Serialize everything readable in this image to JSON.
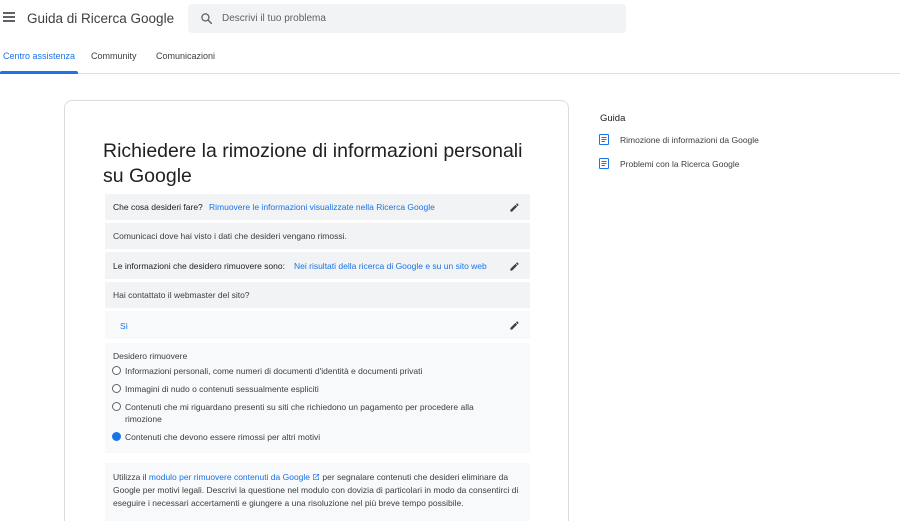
{
  "header": {
    "menu_icon": "hamburger-menu-icon",
    "app_title": "Guida di Ricerca Google",
    "search": {
      "placeholder": "Descrivi il tuo problema",
      "icon": "search-icon"
    }
  },
  "tabs": [
    {
      "label": "Centro assistenza",
      "active": true
    },
    {
      "label": "Community",
      "active": false
    },
    {
      "label": "Comunicazioni",
      "active": false
    }
  ],
  "main": {
    "title": "Richiedere la rimozione di informazioni personali su Google",
    "q1": {
      "label": "Che cosa desideri fare?",
      "answer": "Rimuovere le informazioni visualizzate nella Ricerca Google"
    },
    "instruction": "Comunicaci dove hai visto i dati che desideri vengano rimossi.",
    "q2": {
      "label": "Le informazioni che desidero rimuovere sono:",
      "answer": "Nei risultati della ricerca di Google e su un sito web"
    },
    "q3": {
      "label": "Hai contattato il webmaster del sito?",
      "answer": "Sì"
    },
    "options": {
      "heading": "Desidero rimuovere",
      "items": [
        {
          "label": "Informazioni personali, come numeri di documenti d'identità e documenti privati",
          "checked": false
        },
        {
          "label": "Immagini di nudo o contenuti sessualmente espliciti",
          "checked": false
        },
        {
          "label": "Contenuti che mi riguardano presenti su siti che richiedono un pagamento per procedere alla",
          "label2": "rimozione",
          "checked": false
        },
        {
          "label": "Contenuti che devono essere rimossi per altri motivi",
          "checked": true
        }
      ]
    },
    "info": {
      "prefix": "Utilizza il ",
      "link": "modulo per rimuovere contenuti da Google",
      "suffix": " per segnalare contenuti che desideri eliminare da Google per motivi legali. Descrivi la questione nel modulo con dovizia di particolari in modo da consentirci di eseguire i necessari accertamenti e giungere a una risoluzione nel più breve tempo possibile."
    }
  },
  "sidebar": {
    "title": "Guida",
    "items": [
      {
        "label": "Rimozione di informazioni da Google",
        "icon": "article-icon"
      },
      {
        "label": "Problemi con la Ricerca Google",
        "icon": "article-icon"
      }
    ]
  },
  "colors": {
    "accent": "#1a73e8",
    "panel": "#f1f3f4",
    "text": "#202124"
  }
}
